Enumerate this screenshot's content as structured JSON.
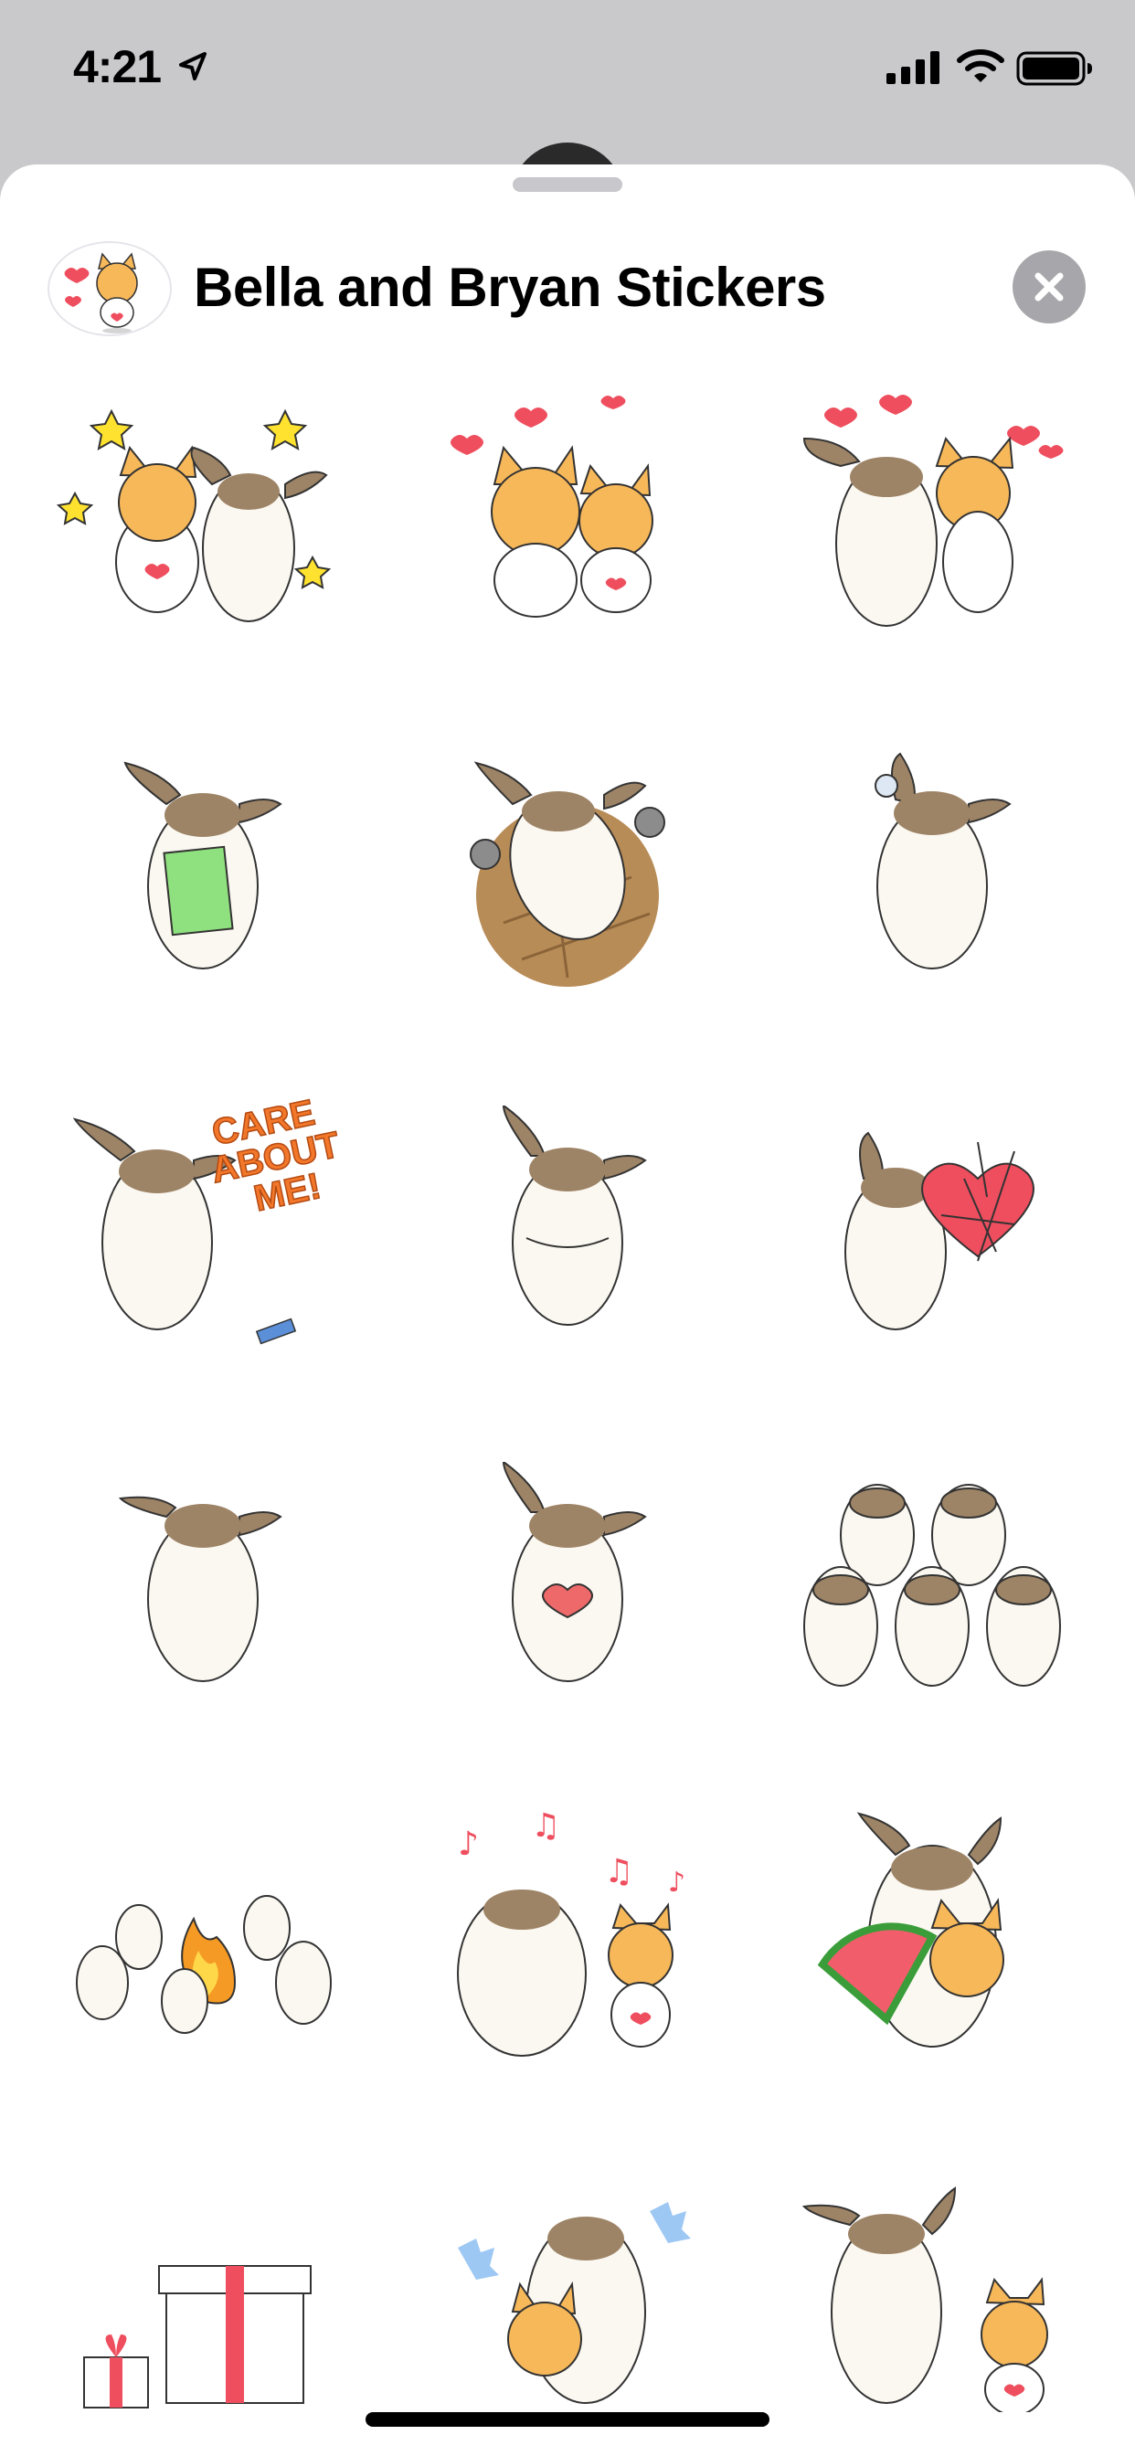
{
  "status_bar": {
    "time": "4:21",
    "icons": [
      "location-arrow-icon",
      "cellular-signal-icon",
      "wifi-icon",
      "battery-icon"
    ]
  },
  "sheet": {
    "title": "Bella and Bryan Stickers",
    "app_icon": "bella-cat-sticker-icon",
    "close_icon": "close-icon"
  },
  "stickers": [
    "bella-bryan-stars",
    "two-cats-hearts",
    "bryan-hug-bella-hearts",
    "bryan-green-card",
    "bryan-dancing-maracas",
    "bryan-bubble",
    "bryan-care-about-me",
    "bryan-arms-crossed",
    "bryan-broken-heart",
    "bryan-standing",
    "bryan-heart-hands",
    "five-bryans-cheering",
    "bryans-campfire",
    "bryan-bella-singing",
    "bryan-bella-watermelon",
    "gift-boxes",
    "bryan-bella-hug-splash",
    "bryan-and-bella"
  ],
  "care_text": [
    "CARE",
    "ABOUT",
    "ME!"
  ],
  "colors": {
    "bryan_body": "#fbf8f1",
    "bryan_patch": "#9e8466",
    "bella_orange": "#f7b85a",
    "heart_red": "#ee4e5e",
    "star_yellow": "#ffe230",
    "card_green": "#8fe07e",
    "care_orange": "#f2772a",
    "close_gray": "#a7a7ab"
  }
}
